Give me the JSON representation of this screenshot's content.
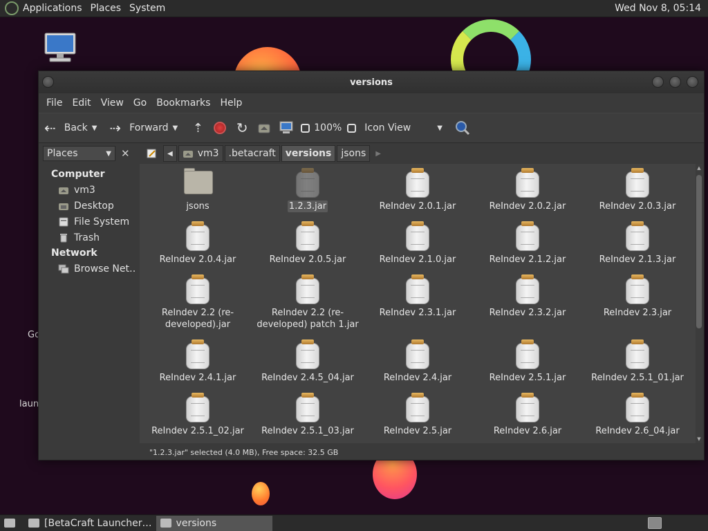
{
  "top_panel": {
    "menus": [
      "Applications",
      "Places",
      "System"
    ],
    "clock": "Wed Nov 8, 05:14"
  },
  "desktop": {
    "labels": [
      "Go",
      "laun"
    ]
  },
  "window": {
    "title": "versions",
    "menubar": [
      "File",
      "Edit",
      "View",
      "Go",
      "Bookmarks",
      "Help"
    ],
    "toolbar": {
      "back_label": "Back",
      "forward_label": "Forward",
      "zoom": "100%",
      "view_mode": "Icon View"
    },
    "sidebar": {
      "selector": "Places",
      "sections": [
        {
          "title": "Computer",
          "items": [
            {
              "label": "vm3",
              "icon": "home-icon"
            },
            {
              "label": "Desktop",
              "icon": "desktop-icon"
            },
            {
              "label": "File System",
              "icon": "filesystem-icon"
            },
            {
              "label": "Trash",
              "icon": "trash-icon"
            }
          ]
        },
        {
          "title": "Network",
          "items": [
            {
              "label": "Browse Net…",
              "icon": "network-icon"
            }
          ]
        }
      ]
    },
    "pathbar": [
      "vm3",
      ".betacraft",
      "versions",
      "jsons"
    ],
    "files": [
      {
        "name": "jsons",
        "type": "folder"
      },
      {
        "name": "1.2.3.jar",
        "type": "jar",
        "selected": true
      },
      {
        "name": "ReIndev 2.0.1.jar",
        "type": "jar"
      },
      {
        "name": "ReIndev 2.0.2.jar",
        "type": "jar"
      },
      {
        "name": "ReIndev 2.0.3.jar",
        "type": "jar"
      },
      {
        "name": "ReIndev 2.0.4.jar",
        "type": "jar"
      },
      {
        "name": "ReIndev 2.0.5.jar",
        "type": "jar"
      },
      {
        "name": "ReIndev 2.1.0.jar",
        "type": "jar"
      },
      {
        "name": "ReIndev 2.1.2.jar",
        "type": "jar"
      },
      {
        "name": "ReIndev 2.1.3.jar",
        "type": "jar"
      },
      {
        "name": "ReIndev 2.2 (re-developed).jar",
        "type": "jar"
      },
      {
        "name": "ReIndev 2.2 (re-developed) patch 1.jar",
        "type": "jar"
      },
      {
        "name": "ReIndev 2.3.1.jar",
        "type": "jar"
      },
      {
        "name": "ReIndev 2.3.2.jar",
        "type": "jar"
      },
      {
        "name": "ReIndev 2.3.jar",
        "type": "jar"
      },
      {
        "name": "ReIndev 2.4.1.jar",
        "type": "jar"
      },
      {
        "name": "ReIndev 2.4.5_04.jar",
        "type": "jar"
      },
      {
        "name": "ReIndev 2.4.jar",
        "type": "jar"
      },
      {
        "name": "ReIndev 2.5.1.jar",
        "type": "jar"
      },
      {
        "name": "ReIndev 2.5.1_01.jar",
        "type": "jar"
      },
      {
        "name": "ReIndev 2.5.1_02.jar",
        "type": "jar"
      },
      {
        "name": "ReIndev 2.5.1_03.jar",
        "type": "jar"
      },
      {
        "name": "ReIndev 2.5.jar",
        "type": "jar"
      },
      {
        "name": "ReIndev 2.6.jar",
        "type": "jar"
      },
      {
        "name": "ReIndev 2.6_04.jar",
        "type": "jar"
      }
    ],
    "status": "\"1.2.3.jar\" selected (4.0 MB), Free space: 32.5 GB"
  },
  "taskbar": {
    "tasks": [
      "[BetaCraft Launcher…",
      "versions"
    ]
  }
}
